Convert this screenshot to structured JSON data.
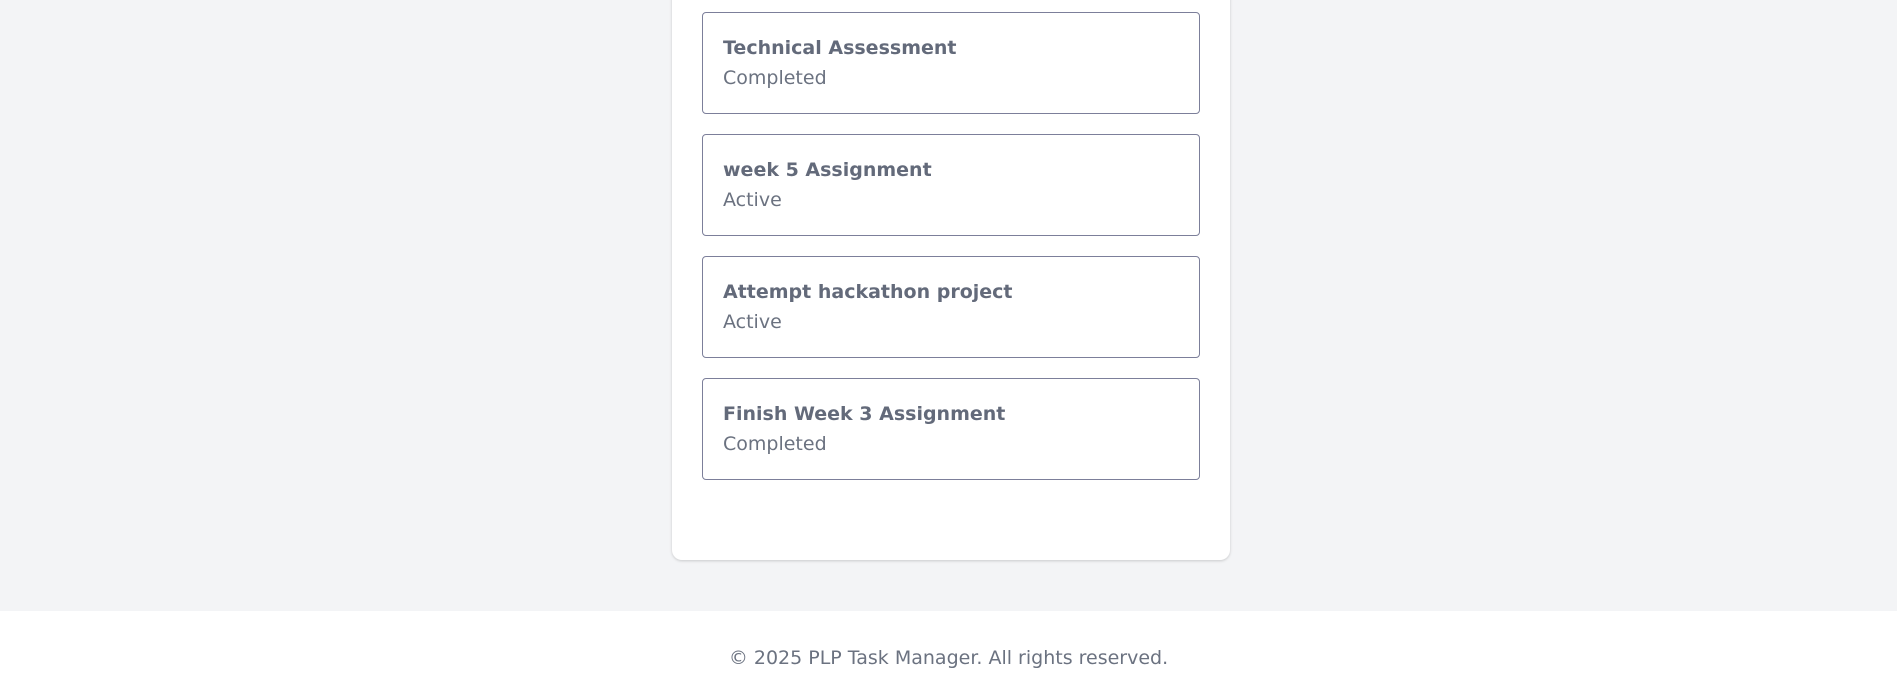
{
  "tasks": [
    {
      "title": "Technical Assessment",
      "status": "Completed"
    },
    {
      "title": "week 5 Assignment",
      "status": "Active"
    },
    {
      "title": "Attempt hackathon project",
      "status": "Active"
    },
    {
      "title": "Finish Week 3 Assignment",
      "status": "Completed"
    }
  ],
  "footer": {
    "copyright": "© 2025 PLP Task Manager. All rights reserved."
  },
  "colors": {
    "page_background": "#f3f4f6",
    "card_border": "#7c7f9a",
    "title_text": "#636a7a",
    "muted_text": "#6b7280"
  }
}
